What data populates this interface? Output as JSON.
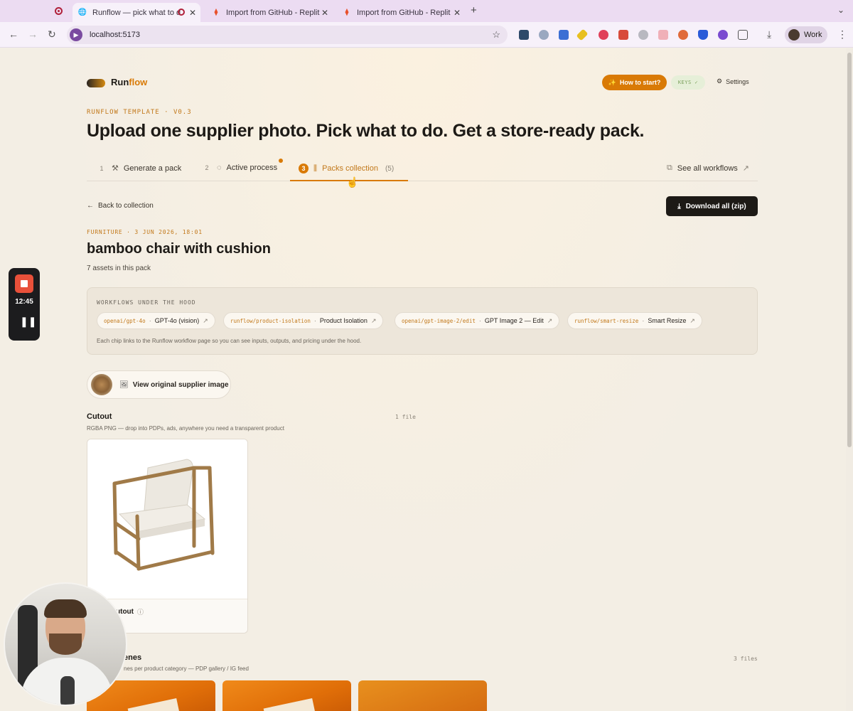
{
  "browser": {
    "tabs": [
      {
        "title": "Runflow — pick what to d",
        "active": true
      },
      {
        "title": "Import from GitHub - Replit",
        "active": false
      },
      {
        "title": "Import from GitHub - Replit",
        "active": false
      }
    ],
    "url": "localhost:5173",
    "profile": "Work"
  },
  "header": {
    "logo_left": "Run",
    "logo_right": "flow",
    "how_to_start": "How to start?",
    "keys_badge": "KEYS ✓",
    "settings": "Settings"
  },
  "hero": {
    "template_label": "RUNFLOW TEMPLATE · V0.3",
    "headline": "Upload one supplier photo. Pick what to do. Get a store-ready pack."
  },
  "steps": [
    {
      "num": "1",
      "label": "Generate a pack"
    },
    {
      "num": "2",
      "label": "Active process"
    },
    {
      "num": "3",
      "label": "Packs collection",
      "count": "(5)"
    }
  ],
  "see_all_workflows": "See all workflows",
  "pack": {
    "back_label": "Back to collection",
    "download_all": "Download all (zip)",
    "meta": "FURNITURE · 3 JUN 2026, 18:01",
    "title": "bamboo chair with cushion",
    "assets_count": "7 assets in this pack"
  },
  "workflows": {
    "label": "WORKFLOWS UNDER THE HOOD",
    "chips": [
      {
        "code": "openai/gpt-4o",
        "name": "GPT-4o (vision)"
      },
      {
        "code": "runflow/product-isolation",
        "name": "Product Isolation"
      },
      {
        "code": "openai/gpt-image-2/edit",
        "name": "GPT Image 2 — Edit"
      },
      {
        "code": "runflow/smart-resize",
        "name": "Smart Resize"
      }
    ],
    "note": "Each chip links to the Runflow workflow page so you can see inputs, outputs, and pricing under the hood."
  },
  "original_image_button": "View original supplier image",
  "sections": {
    "cutout": {
      "title": "Cutout",
      "desc": "RGBA PNG — drop into PDPs, ads, anywhere you need a transparent product",
      "count": "1 file",
      "card_name": "utout",
      "card_download": "ad"
    },
    "scenes": {
      "title": "enes",
      "desc": "nes per product category — PDP gallery / IG feed",
      "count": "3 files"
    }
  },
  "recorder": {
    "time": "12:45"
  },
  "colors": {
    "accent": "#d97a06",
    "page_bg": "#f3eee4",
    "dark_button": "#1d1a16"
  }
}
